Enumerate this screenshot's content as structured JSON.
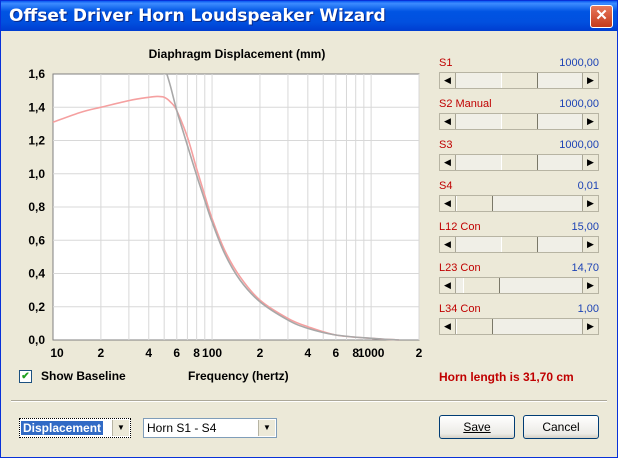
{
  "window": {
    "title": "Offset Driver Horn Loudspeaker Wizard",
    "close_glyph": "✕"
  },
  "chart_data": {
    "type": "line",
    "title": "Diaphragm Displacement (mm)",
    "xlabel": "Frequency (hertz)",
    "ylabel": "",
    "xscale": "log",
    "xlim": [
      10,
      2000
    ],
    "ylim": [
      0,
      1.6
    ],
    "y_ticks": [
      "0,0",
      "0,2",
      "0,4",
      "0,6",
      "0,8",
      "1,0",
      "1,2",
      "1,4",
      "1,6"
    ],
    "x_ticks": [
      "10",
      "2",
      "4",
      "6",
      "8",
      "100",
      "2",
      "4",
      "6",
      "8",
      "1000",
      "2"
    ],
    "grid": true,
    "series": [
      {
        "color": "#f5a0a0",
        "x": [
          10,
          15,
          20,
          30,
          40,
          45,
          50,
          55,
          60,
          70,
          80,
          90,
          100,
          120,
          150,
          200,
          300,
          400,
          600,
          1000,
          1500
        ],
        "y": [
          1.31,
          1.37,
          1.4,
          1.44,
          1.46,
          1.465,
          1.46,
          1.43,
          1.38,
          1.22,
          1.03,
          0.87,
          0.73,
          0.54,
          0.38,
          0.24,
          0.13,
          0.08,
          0.03,
          0.01,
          0.0
        ]
      },
      {
        "color": "#a8a8a8",
        "x": [
          52,
          55,
          60,
          65,
          70,
          80,
          90,
          100,
          120,
          150,
          200,
          300,
          400,
          600,
          1000,
          1500
        ],
        "y": [
          1.6,
          1.52,
          1.38,
          1.27,
          1.17,
          0.99,
          0.84,
          0.71,
          0.52,
          0.36,
          0.23,
          0.12,
          0.07,
          0.03,
          0.01,
          0.0
        ]
      }
    ]
  },
  "sliders": [
    {
      "label": "S1",
      "value": "1000,00",
      "position": 0.5
    },
    {
      "label": "S2  Manual",
      "value": "1000,00",
      "position": 0.5
    },
    {
      "label": "S3",
      "value": "1000,00",
      "position": 0.5
    },
    {
      "label": "S4",
      "value": "0,01",
      "position": 0.0
    },
    {
      "label": "L12  Con",
      "value": "15,00",
      "position": 0.5
    },
    {
      "label": "L23  Con",
      "value": "14,70",
      "position": 0.08
    },
    {
      "label": "L34  Con",
      "value": "1,00",
      "position": 0.0
    }
  ],
  "baseline": {
    "label": "Show Baseline",
    "checked": true,
    "check_glyph": "✔"
  },
  "horn_length": "Horn length is 31,70 cm",
  "bottom": {
    "plot_select": "Displacement",
    "horn_select": "Horn S1 - S4",
    "save_label": "Save",
    "cancel_label": "Cancel",
    "arrow_glyph": "▼"
  },
  "colors": {
    "label_red": "#c00000",
    "value_blue": "#1d43b5",
    "curve_pink": "#f5a0a0",
    "curve_grey": "#a8a8a8"
  }
}
